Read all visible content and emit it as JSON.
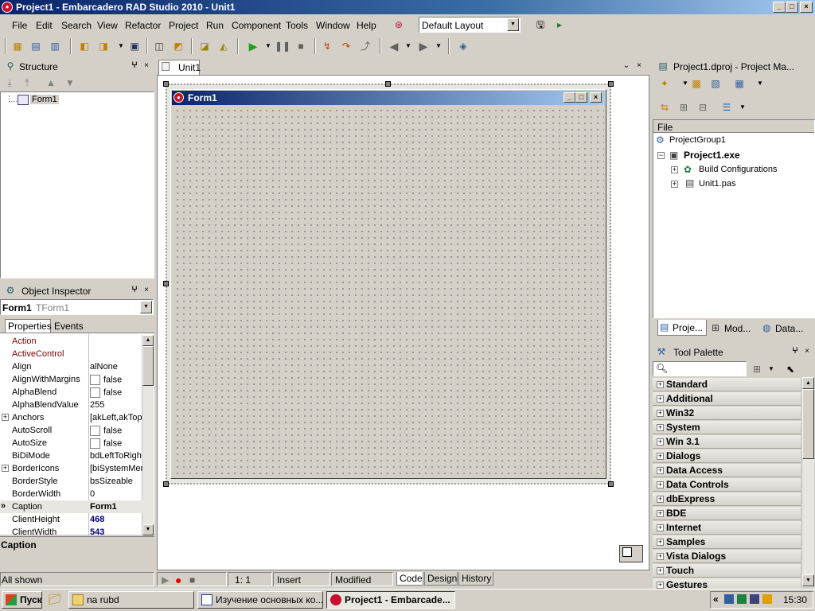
{
  "window": {
    "title": "Project1 - Embarcadero RAD Studio 2010 - Unit1",
    "min": "_",
    "max": "□",
    "close": "×"
  },
  "menu": {
    "items": [
      "File",
      "Edit",
      "Search",
      "View",
      "Refactor",
      "Project",
      "Run",
      "Component",
      "Tools",
      "Window",
      "Help"
    ],
    "layout_value": "Default Layout"
  },
  "structure": {
    "title": "Structure",
    "tree_root": "Form1"
  },
  "editor": {
    "tab_label": "Unit1",
    "form_caption": "Form1"
  },
  "object_inspector": {
    "title": "Object Inspector",
    "selected_name": "Form1",
    "selected_type": "TForm1",
    "tabs": [
      "Properties",
      "Events"
    ],
    "properties": [
      {
        "name": "Action",
        "value": "",
        "kind": "red"
      },
      {
        "name": "ActiveControl",
        "value": "",
        "kind": "red"
      },
      {
        "name": "Align",
        "value": "alNone"
      },
      {
        "name": "AlignWithMargins",
        "value": "false",
        "check": true
      },
      {
        "name": "AlphaBlend",
        "value": "false",
        "check": true
      },
      {
        "name": "AlphaBlendValue",
        "value": "255"
      },
      {
        "name": "Anchors",
        "value": "[akLeft,akTop",
        "expand": true
      },
      {
        "name": "AutoScroll",
        "value": "false",
        "check": true
      },
      {
        "name": "AutoSize",
        "value": "false",
        "check": true
      },
      {
        "name": "BiDiMode",
        "value": "bdLeftToRigh"
      },
      {
        "name": "BorderIcons",
        "value": "[biSystemMen",
        "expand": true
      },
      {
        "name": "BorderStyle",
        "value": "bsSizeable"
      },
      {
        "name": "BorderWidth",
        "value": "0"
      },
      {
        "name": "Caption",
        "value": "Form1",
        "selected": true,
        "bold": true
      },
      {
        "name": "ClientHeight",
        "value": "468",
        "bold": true,
        "blue": true
      },
      {
        "name": "ClientWidth",
        "value": "543",
        "bold": true,
        "blue": true
      }
    ],
    "description": "Caption",
    "status": "All shown"
  },
  "status_bar": {
    "position": "1:   1",
    "mode": "Insert",
    "state": "Modified",
    "tabs": [
      "Code",
      "Design",
      "History"
    ]
  },
  "project_manager": {
    "title": "Project1.dproj - Project Ma...",
    "column": "File",
    "group": "ProjectGroup1",
    "project": "Project1.exe",
    "build": "Build Configurations",
    "unit": "Unit1.pas",
    "tabs": [
      "Proje...",
      "Mod...",
      "Data..."
    ]
  },
  "tool_palette": {
    "title": "Tool Palette",
    "search_placeholder": "",
    "categories": [
      "Standard",
      "Additional",
      "Win32",
      "System",
      "Win 3.1",
      "Dialogs",
      "Data Access",
      "Data Controls",
      "dbExpress",
      "BDE",
      "Internet",
      "Samples",
      "Vista Dialogs",
      "Touch",
      "Gestures"
    ]
  },
  "taskbar": {
    "start": "Пуск",
    "buttons": [
      "na rubd",
      "Изучение основных ко...",
      "Project1 - Embarcade..."
    ],
    "clock": "15:30"
  },
  "colors": {
    "title_gradient_start": "#0a246a",
    "title_gradient_end": "#a6caf0",
    "property_red": "#800000",
    "value_blue": "#000080"
  }
}
